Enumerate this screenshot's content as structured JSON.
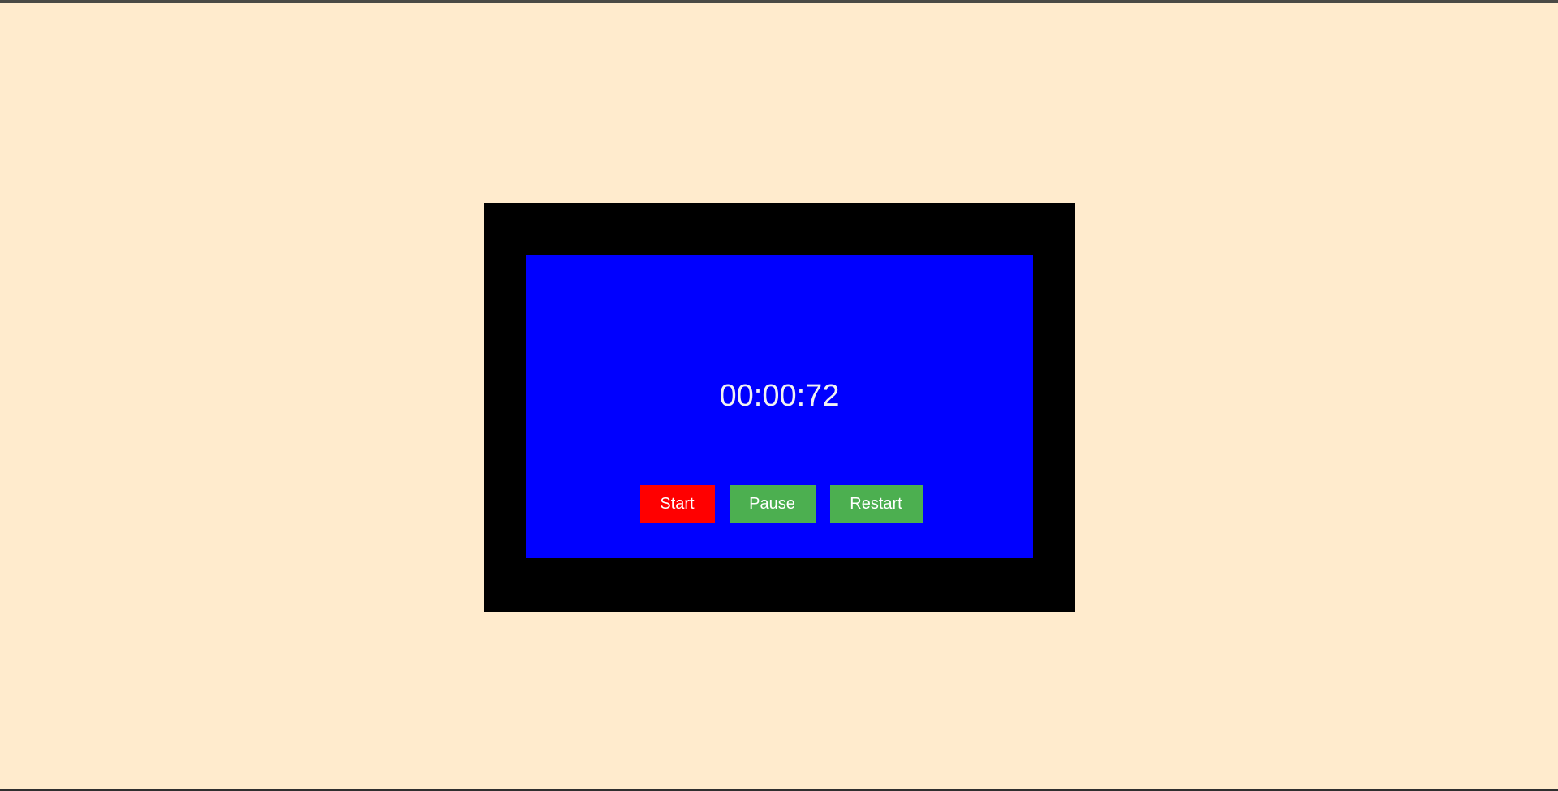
{
  "stopwatch": {
    "time": "00:00:72",
    "buttons": {
      "start": "Start",
      "pause": "Pause",
      "restart": "Restart"
    }
  },
  "colors": {
    "page_background": "#ffebcd",
    "frame": "#000000",
    "screen": "#0000ff",
    "start_button": "#ff0000",
    "secondary_buttons": "#4caf50",
    "text": "#ffffff"
  }
}
